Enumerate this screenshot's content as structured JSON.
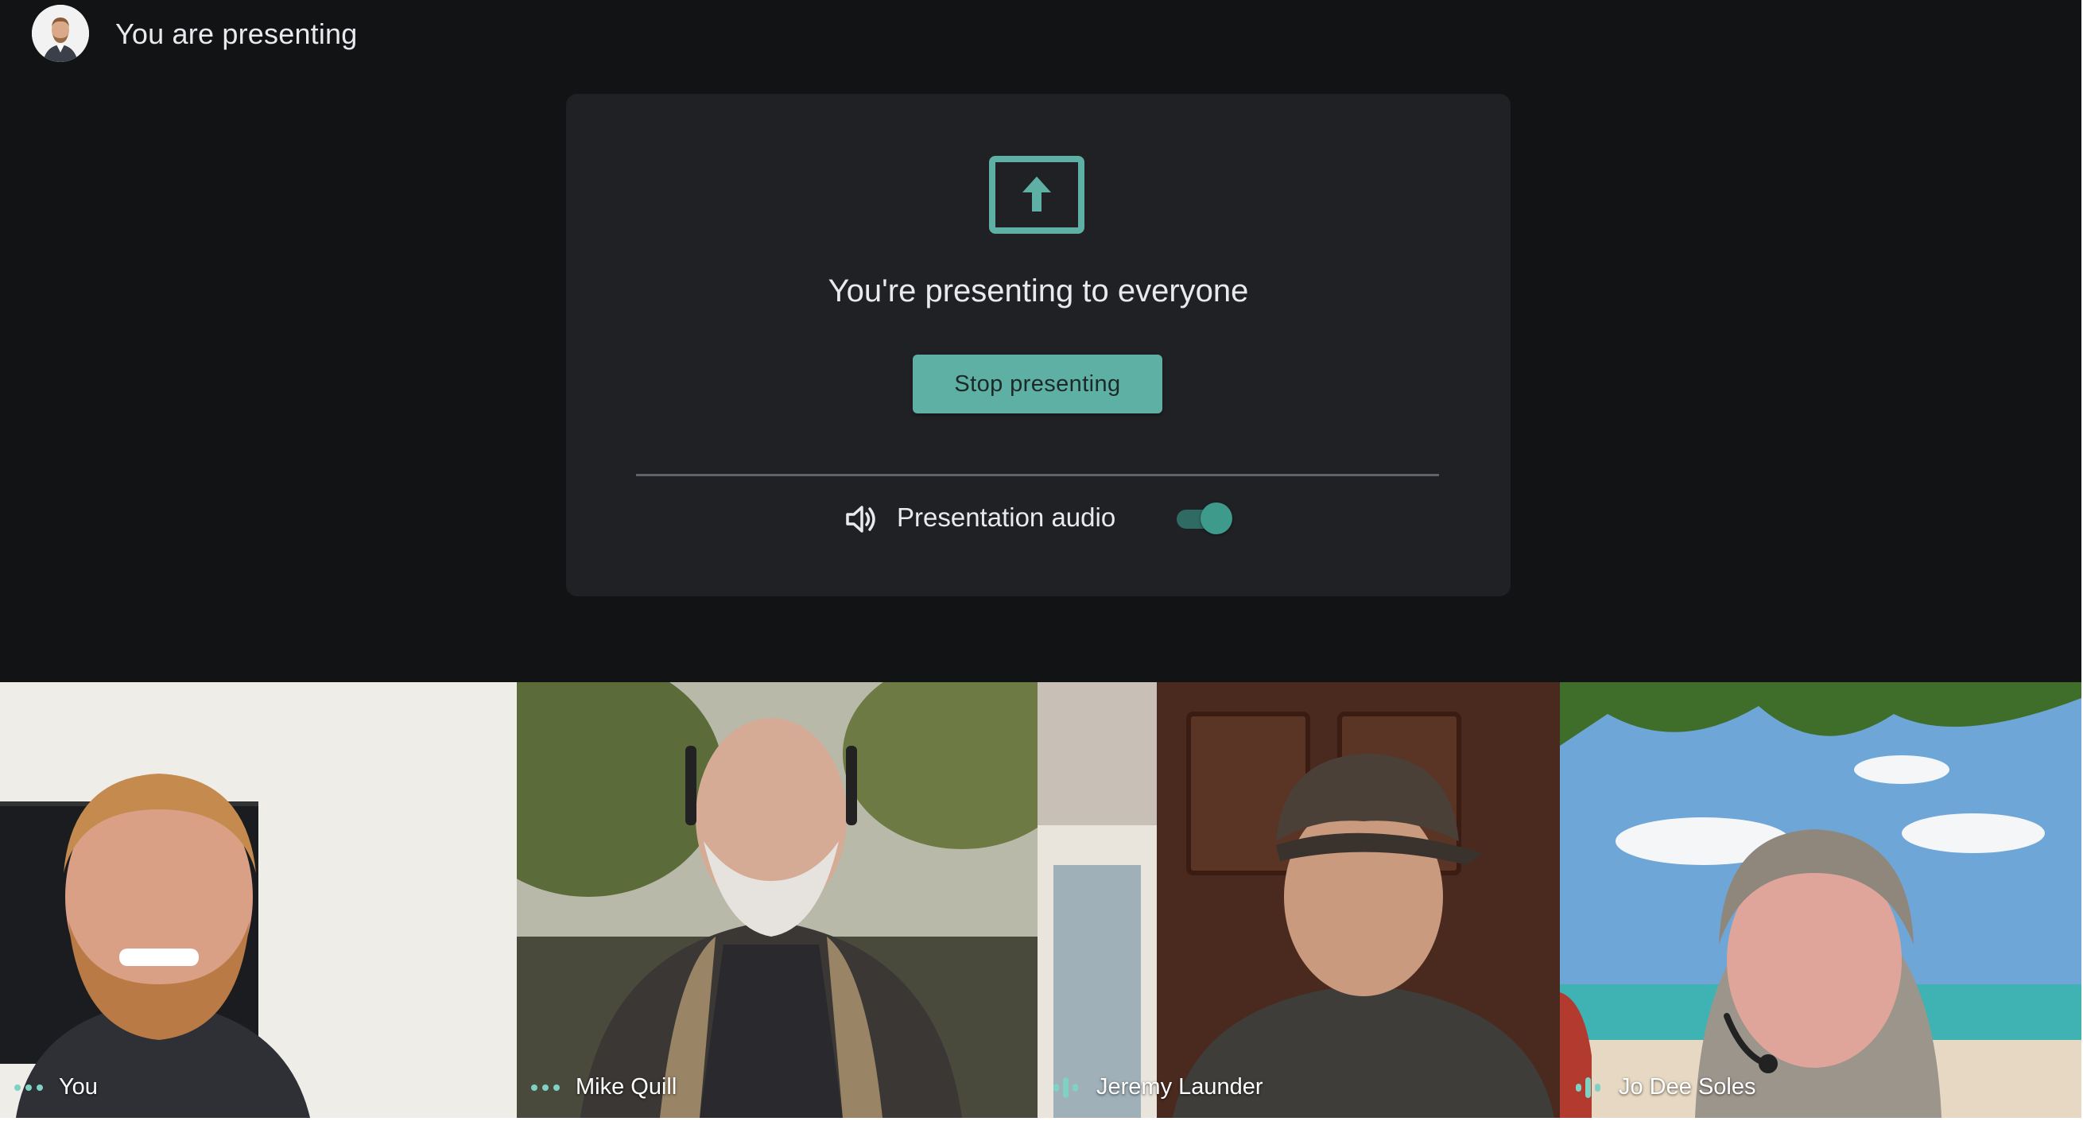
{
  "header": {
    "title": "You are presenting",
    "avatar_icon": "presenter-avatar"
  },
  "present_card": {
    "icon": "present-to-all-icon",
    "heading": "You're presenting to everyone",
    "stop_button_label": "Stop presenting",
    "audio_icon": "volume-icon",
    "audio_label": "Presentation audio",
    "audio_enabled": true
  },
  "participants": [
    {
      "name": "You",
      "status_icon": "more-dots-icon"
    },
    {
      "name": "Mike Quill",
      "status_icon": "more-dots-icon"
    },
    {
      "name": "Jeremy Launder",
      "status_icon": "speaking-bars-icon"
    },
    {
      "name": "Jo Dee Soles",
      "status_icon": "speaking-bars-icon"
    }
  ],
  "colors": {
    "background": "#121314",
    "card": "#202124",
    "accent": "#5fb0a4",
    "text": "#e8eaed"
  }
}
